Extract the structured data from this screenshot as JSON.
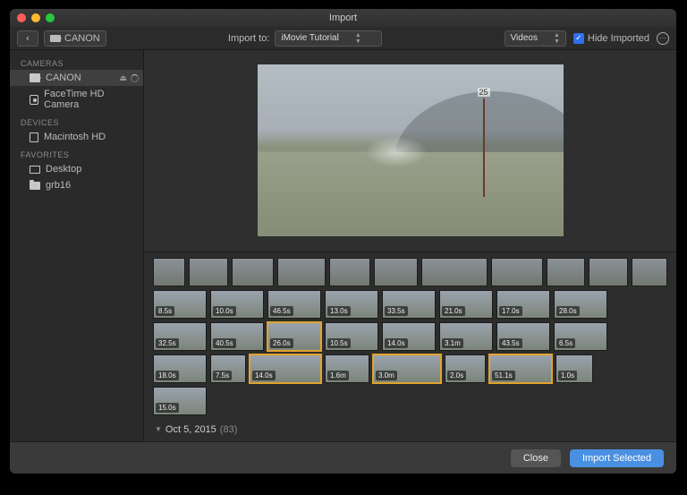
{
  "window": {
    "title": "Import"
  },
  "toolbar": {
    "camera_label": "CANON",
    "import_to_label": "Import to:",
    "import_to_value": "iMovie Tutorial",
    "filter_value": "Videos",
    "hide_imported_label": "Hide Imported",
    "hide_imported_checked": true
  },
  "sidebar": {
    "sections": [
      {
        "header": "CAMERAS",
        "items": [
          {
            "label": "CANON",
            "icon": "cam",
            "selected": true,
            "eject": true,
            "busy": true
          },
          {
            "label": "FaceTime HD Camera",
            "icon": "web"
          }
        ]
      },
      {
        "header": "DEVICES",
        "items": [
          {
            "label": "Macintosh HD",
            "icon": "hd"
          }
        ]
      },
      {
        "header": "FAVORITES",
        "items": [
          {
            "label": "Desktop",
            "icon": "desk"
          },
          {
            "label": "grb16",
            "icon": "fold"
          }
        ]
      }
    ]
  },
  "strip": {
    "rows": [
      [
        {
          "w": 36
        },
        {
          "w": 44
        },
        {
          "w": 48
        },
        {
          "w": 54
        },
        {
          "w": 46
        },
        {
          "w": 50
        },
        {
          "w": 74
        },
        {
          "w": 58
        },
        {
          "w": 44
        },
        {
          "w": 44
        },
        {
          "w": 40
        }
      ],
      [
        {
          "w": 60,
          "dur": "8.5s"
        },
        {
          "w": 60,
          "dur": "10.0s"
        },
        {
          "w": 60,
          "dur": "46.5s"
        },
        {
          "w": 60,
          "dur": "13.0s"
        },
        {
          "w": 60,
          "dur": "33.5s"
        },
        {
          "w": 60,
          "dur": "21.0s"
        },
        {
          "w": 60,
          "dur": "17.0s"
        },
        {
          "w": 60,
          "dur": "28.0s"
        }
      ],
      [
        {
          "w": 60,
          "dur": "32.5s"
        },
        {
          "w": 60,
          "dur": "40.5s"
        },
        {
          "w": 60,
          "dur": "26.0s",
          "sel": true
        },
        {
          "w": 60,
          "dur": "10.5s"
        },
        {
          "w": 60,
          "dur": "14.0s"
        },
        {
          "w": 60,
          "dur": "3.1m"
        },
        {
          "w": 60,
          "dur": "43.5s"
        },
        {
          "w": 60,
          "dur": "6.5s"
        }
      ],
      [
        {
          "w": 60,
          "dur": "18.0s"
        },
        {
          "w": 40,
          "dur": "7.5s"
        },
        {
          "w": 80,
          "dur": "14.0s",
          "sel": true
        },
        {
          "w": 50,
          "dur": "1.6m"
        },
        {
          "w": 76,
          "dur": "3.0m",
          "sel": true
        },
        {
          "w": 46,
          "dur": "2.0s"
        },
        {
          "w": 70,
          "dur": "51.1s",
          "sel": true
        },
        {
          "w": 42,
          "dur": "1.0s"
        }
      ],
      [
        {
          "w": 60,
          "dur": "15.0s"
        }
      ]
    ]
  },
  "event": {
    "disclosure": "▼",
    "title": "Oct 5, 2015",
    "count": "(83)"
  },
  "footer": {
    "close_label": "Close",
    "import_label": "Import Selected"
  }
}
